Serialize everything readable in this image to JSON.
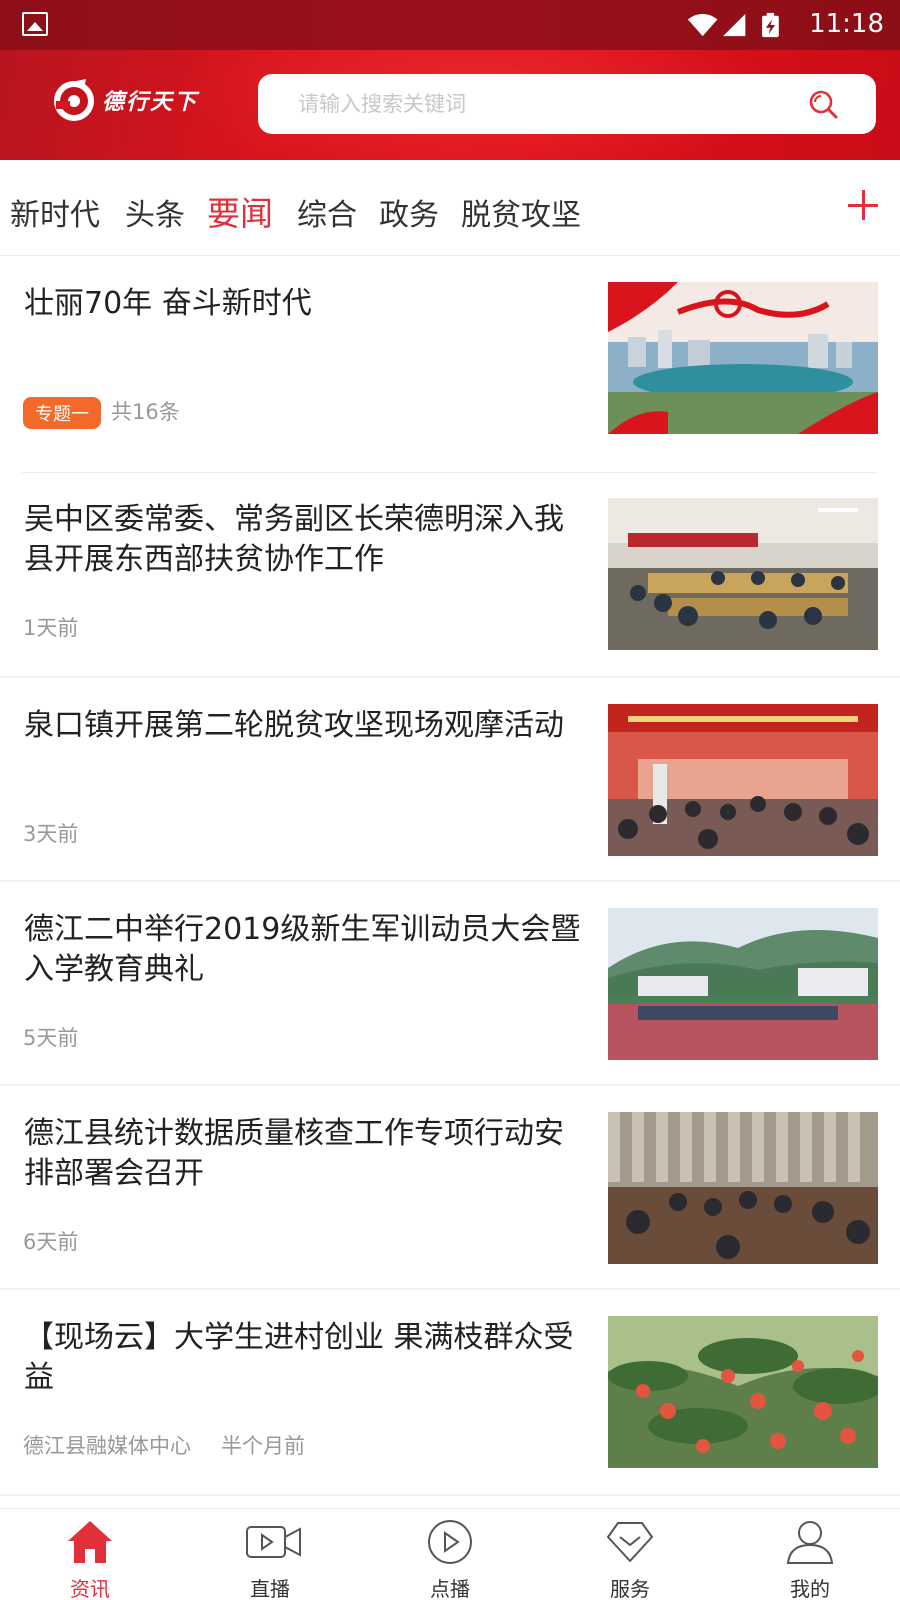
{
  "status_bar": {
    "time": "11:18",
    "icons": [
      "image-icon",
      "wifi-icon",
      "signal-icon",
      "battery-charging-icon"
    ]
  },
  "header": {
    "logo_text": "德行天下",
    "search_placeholder": "请输入搜索关键词"
  },
  "tabs": {
    "items": [
      "新时代",
      "头条",
      "要闻",
      "综合",
      "政务",
      "脱贫攻坚"
    ],
    "active_index": 2,
    "add_icon": "plus-icon"
  },
  "news": [
    {
      "title": "壮丽70年  奋斗新时代",
      "tag": "专题一",
      "meta": "共16条"
    },
    {
      "title": "吴中区委常委、常务副区长荣德明深入我县开展东西部扶贫协作工作",
      "meta": "1天前"
    },
    {
      "title": "泉口镇开展第二轮脱贫攻坚现场观摩活动",
      "meta": "3天前"
    },
    {
      "title": " 德江二中举行2019级新生军训动员大会暨入学教育典礼",
      "meta": "5天前"
    },
    {
      "title": "德江县统计数据质量核查工作专项行动安排部署会召开",
      "meta": "6天前"
    },
    {
      "title": "【现场云】大学生进村创业 果满枝群众受益",
      "source": "德江县融媒体中心",
      "meta": "半个月前"
    }
  ],
  "bottom_nav": {
    "items": [
      {
        "label": "资讯",
        "icon": "home-icon"
      },
      {
        "label": "直播",
        "icon": "video-camera-icon"
      },
      {
        "label": "点播",
        "icon": "play-circle-icon"
      },
      {
        "label": "服务",
        "icon": "heart-service-icon"
      },
      {
        "label": "我的",
        "icon": "user-icon"
      }
    ],
    "active_index": 0
  },
  "colors": {
    "brand_red": "#e2303a",
    "header_red": "#d9141d",
    "status_bar": "#8e0f18",
    "tag_orange": "#f26a2a"
  }
}
